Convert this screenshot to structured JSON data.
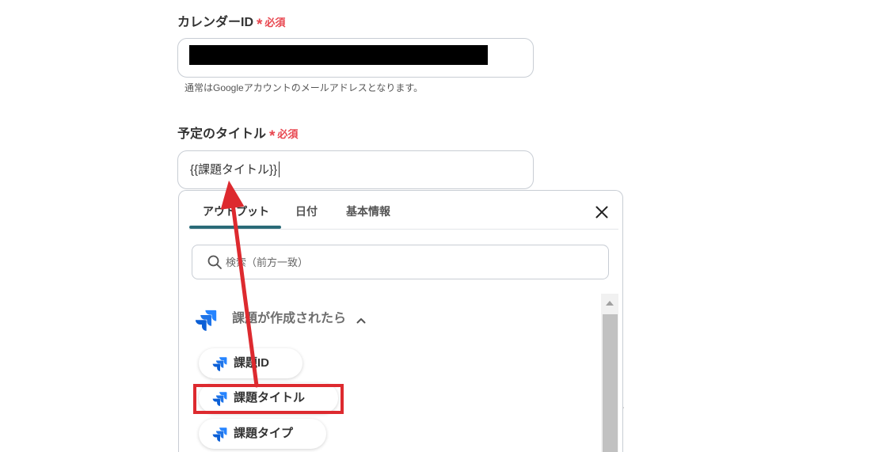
{
  "form": {
    "calendar_id": {
      "label": "カレンダーID",
      "required_mark": "*",
      "required_text": "必須",
      "value_redacted": true,
      "help_text": "通常はGoogleアカウントのメールアドレスとなります。"
    },
    "event_title": {
      "label": "予定のタイトル",
      "required_mark": "*",
      "required_text": "必須",
      "value": "{{課題タイトル}}"
    }
  },
  "picker": {
    "tabs": [
      {
        "label": "アウトプット",
        "active": true
      },
      {
        "label": "日付",
        "active": false
      },
      {
        "label": "基本情報",
        "active": false
      }
    ],
    "close_icon": "close-icon",
    "search": {
      "placeholder": "検索（前方一致）",
      "value": "",
      "icon": "search-icon"
    },
    "section": {
      "title": "課題が作成されたら",
      "icon": "jira-icon",
      "expanded": true,
      "toggle_icon": "chevron-up-icon",
      "items": [
        {
          "label": "課題ID",
          "icon": "jira-icon",
          "highlighted": false
        },
        {
          "label": "課題タイトル",
          "icon": "jira-icon",
          "highlighted": true
        },
        {
          "label": "課題タイプ",
          "icon": "jira-icon",
          "highlighted": false
        }
      ]
    }
  },
  "background_fragment": "。",
  "colors": {
    "required": "#e8464f",
    "active_tab_underline": "#2a6b78",
    "annotation": "#dd2a2f",
    "border": "#c8cdd4",
    "jira_blue": "#2684ff",
    "jira_blue_dark": "#0b5fd6"
  }
}
